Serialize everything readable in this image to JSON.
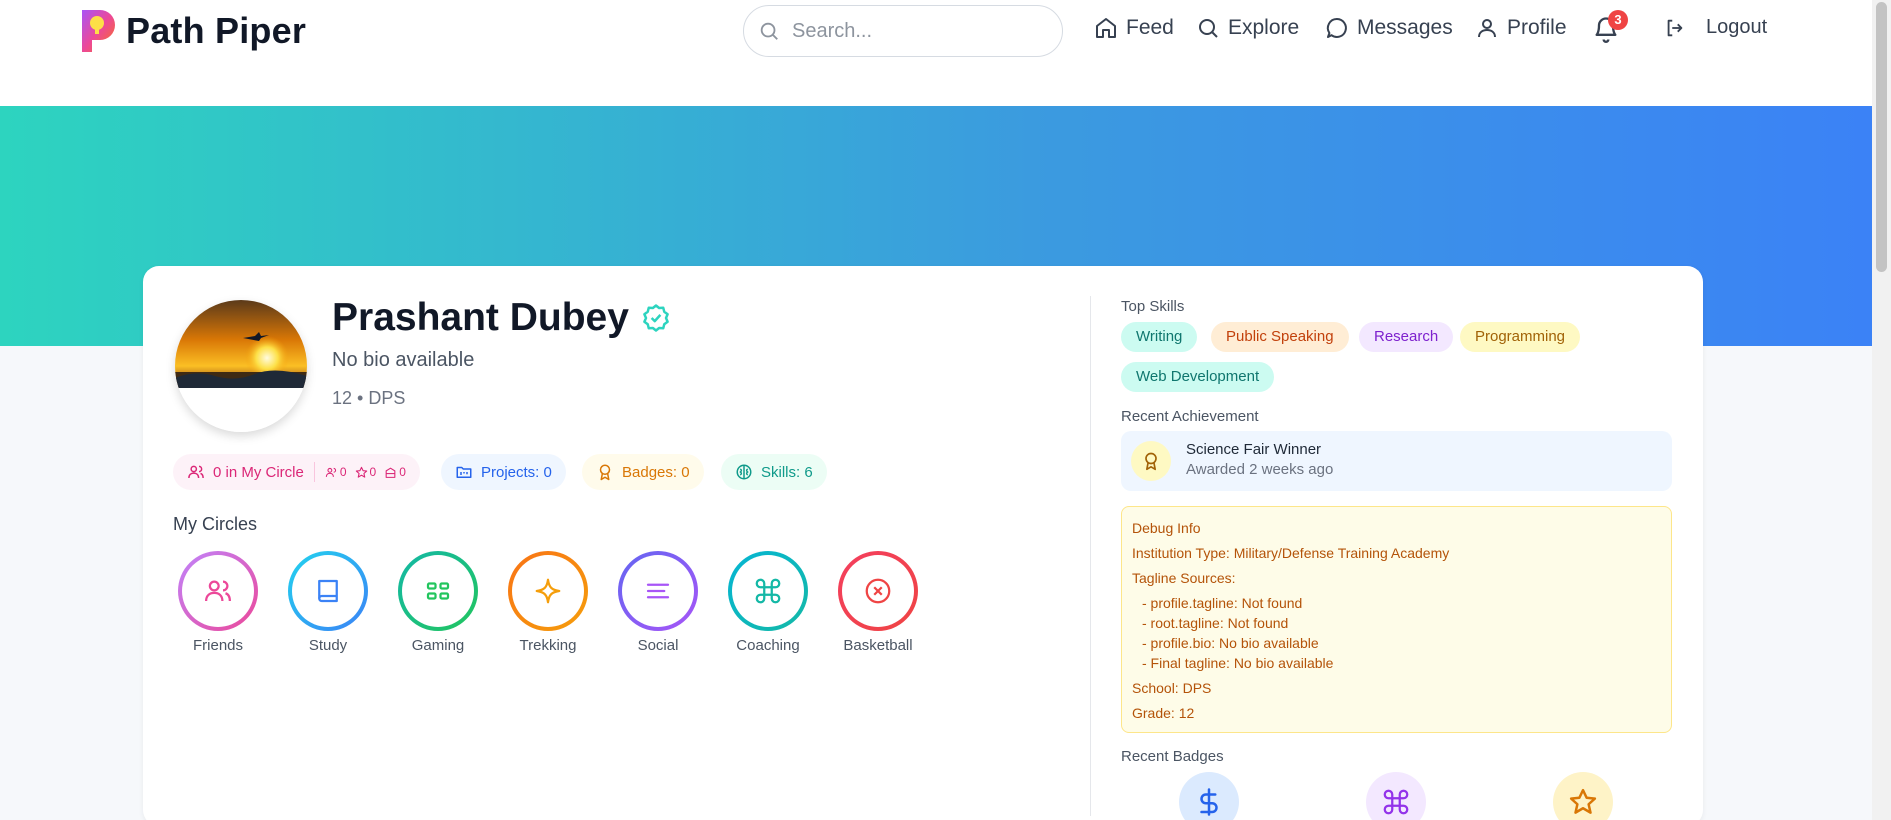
{
  "header": {
    "app_name": "Path Piper",
    "search_placeholder": "Search...",
    "nav": {
      "feed": "Feed",
      "explore": "Explore",
      "messages": "Messages",
      "profile": "Profile",
      "notifications_count": "3",
      "logout": "Logout"
    }
  },
  "profile": {
    "name": "Prashant Dubey",
    "bio": "No bio available",
    "meta": "12 • DPS",
    "stats": {
      "circle": "0 in My Circle",
      "circle_mini": [
        "0",
        "0",
        "0"
      ],
      "projects": "Projects: 0",
      "badges": "Badges: 0",
      "skills": "Skills: 6"
    },
    "circles_title": "My Circles",
    "circles": [
      {
        "label": "Friends",
        "icon": "users-icon",
        "ring": "#ec4899",
        "ring2": "#c084fc",
        "icon_color": "#ec4899"
      },
      {
        "label": "Study",
        "icon": "book-icon",
        "ring": "#3b82f6",
        "ring2": "#22d3ee",
        "icon_color": "#3b82f6"
      },
      {
        "label": "Gaming",
        "icon": "grid-icon",
        "ring": "#22c55e",
        "ring2": "#14b8a6",
        "icon_color": "#22c55e"
      },
      {
        "label": "Trekking",
        "icon": "sparkle-icon",
        "ring": "#f59e0b",
        "ring2": "#f97316",
        "icon_color": "#f59e0b"
      },
      {
        "label": "Social",
        "icon": "lines-icon",
        "ring": "#a855f7",
        "ring2": "#6366f1",
        "icon_color": "#a855f7"
      },
      {
        "label": "Coaching",
        "icon": "command-icon",
        "ring": "#14b8a6",
        "ring2": "#06b6d4",
        "icon_color": "#14b8a6"
      },
      {
        "label": "Basketball",
        "icon": "x-circle-icon",
        "ring": "#ef4444",
        "ring2": "#f43f5e",
        "icon_color": "#ef4444"
      }
    ]
  },
  "sidebar": {
    "top_skills_title": "Top Skills",
    "skills": [
      {
        "label": "Writing",
        "bg": "#ccfbf1",
        "fg": "#0f766e"
      },
      {
        "label": "Public Speaking",
        "bg": "#ffedd5",
        "fg": "#c2410c"
      },
      {
        "label": "Research",
        "bg": "#f3e8ff",
        "fg": "#7e22ce"
      },
      {
        "label": "Programming",
        "bg": "#fef9c3",
        "fg": "#a16207"
      },
      {
        "label": "Web Development",
        "bg": "#ccfbf1",
        "fg": "#0f766e"
      }
    ],
    "recent_achievement_title": "Recent Achievement",
    "achievement": {
      "title": "Science Fair Winner",
      "subtitle": "Awarded 2 weeks ago"
    },
    "debug": {
      "title": "Debug Info",
      "institution": "Institution Type: Military/Defense Training Academy",
      "sources_title": "Tagline Sources:",
      "sources": [
        "- profile.tagline: Not found",
        "- root.tagline: Not found",
        "- profile.bio: No bio available",
        "- Final tagline: No bio available"
      ],
      "school": "School: DPS",
      "grade": "Grade: 12"
    },
    "recent_badges_title": "Recent Badges",
    "badges": [
      {
        "icon": "dollar-icon",
        "bg": "#dbeafe",
        "fg": "#2563eb"
      },
      {
        "icon": "command-icon",
        "bg": "#f3e8ff",
        "fg": "#9333ea"
      },
      {
        "icon": "star-icon",
        "bg": "#fef3c7",
        "fg": "#d97706"
      }
    ]
  }
}
